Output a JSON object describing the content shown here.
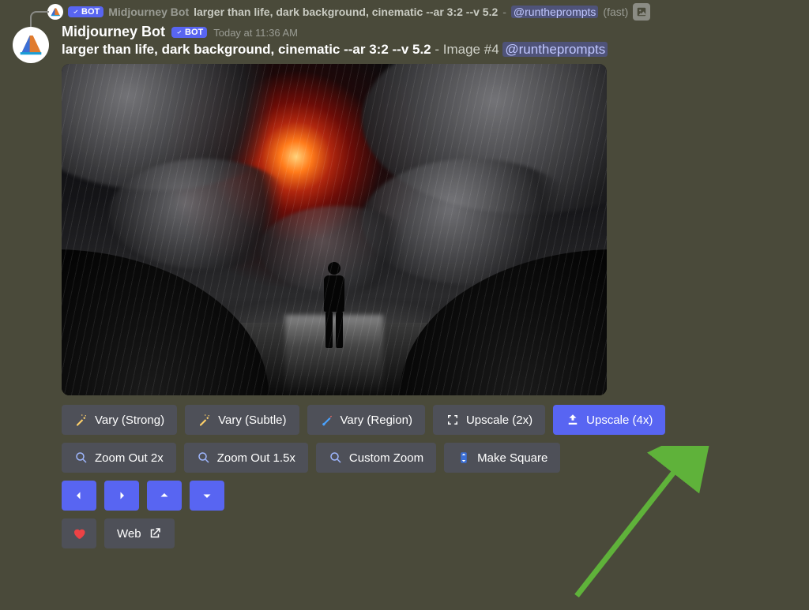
{
  "reply": {
    "bot_badge": "BOT",
    "bot_name": "Midjourney Bot",
    "prompt": "larger than life, dark background, cinematic --ar 3:2 --v 5.2",
    "mention": "@runtheprompts",
    "mode": "(fast)"
  },
  "message": {
    "bot_name": "Midjourney Bot",
    "bot_badge": "BOT",
    "timestamp": "Today at 11:36 AM",
    "prompt": "larger than life, dark background, cinematic --ar 3:2 --v 5.2",
    "image_suffix": " - Image #4 ",
    "mention": "@runtheprompts"
  },
  "buttons": {
    "row1": {
      "vary_strong": "Vary (Strong)",
      "vary_subtle": "Vary (Subtle)",
      "vary_region": "Vary (Region)",
      "upscale_2x": "Upscale (2x)",
      "upscale_4x": "Upscale (4x)"
    },
    "row2": {
      "zoom_out_2x": "Zoom Out 2x",
      "zoom_out_15x": "Zoom Out 1.5x",
      "custom_zoom": "Custom Zoom",
      "make_square": "Make Square"
    },
    "row4": {
      "web": "Web"
    }
  }
}
